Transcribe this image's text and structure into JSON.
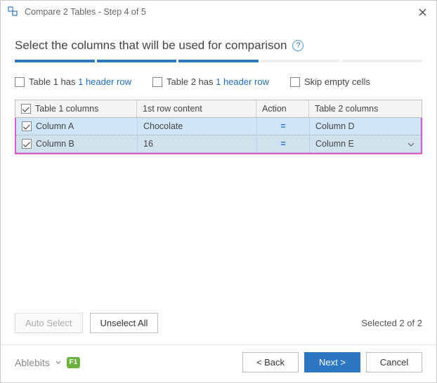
{
  "titlebar": {
    "title": "Compare 2 Tables - Step 4 of 5"
  },
  "heading": "Select the columns that will be used for comparison",
  "progress_steps": 5,
  "progress_done": 3,
  "options": {
    "table1_prefix": "Table 1  has ",
    "table1_link": "1 header row",
    "table2_prefix": "Table 2 has ",
    "table2_link": "1 header row",
    "skip_empty": "Skip empty cells"
  },
  "table": {
    "headers": {
      "col1": "Table 1 columns",
      "col2": "1st row content",
      "col3": "Action",
      "col4": "Table 2 columns"
    },
    "rows": [
      {
        "c1": "Column A",
        "c2": "Chocolate",
        "c3": "=",
        "c4": "Column D",
        "checked": true
      },
      {
        "c1": "Column B",
        "c2": "16",
        "c3": "=",
        "c4": "Column E",
        "checked": true
      }
    ]
  },
  "buttons": {
    "auto_select": "Auto Select",
    "unselect_all": "Unselect All",
    "back": "< Back",
    "next": "Next >",
    "cancel": "Cancel"
  },
  "selection_text": "Selected 2 of 2",
  "brand": "Ablebits",
  "f1": "F1"
}
